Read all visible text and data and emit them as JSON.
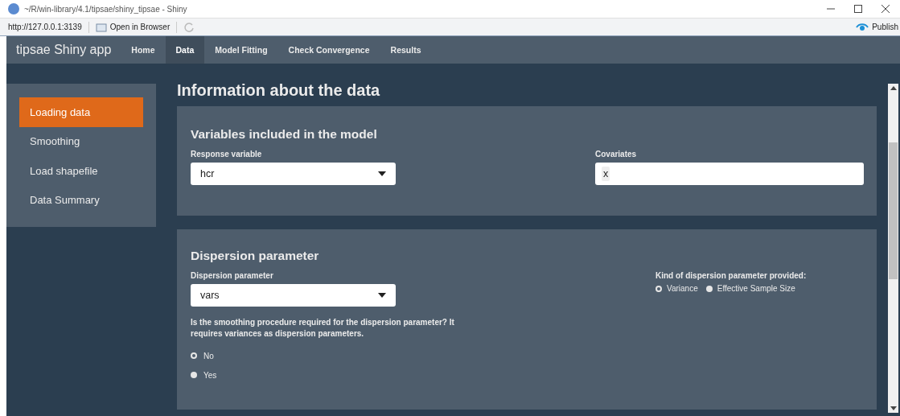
{
  "window": {
    "title": "~/R/win-library/4.1/tipsae/shiny_tipsae - Shiny"
  },
  "toolbar": {
    "url": "http://127.0.0.1:3139",
    "open_in_browser": "Open in Browser",
    "publish": "Publish"
  },
  "navbar": {
    "brand": "tipsae Shiny app",
    "tabs": [
      {
        "label": "Home",
        "selected": false
      },
      {
        "label": "Data",
        "selected": true
      },
      {
        "label": "Model Fitting",
        "selected": false
      },
      {
        "label": "Check Convergence",
        "selected": false
      },
      {
        "label": "Results",
        "selected": false
      }
    ]
  },
  "sidebar": {
    "items": [
      {
        "label": "Loading data",
        "selected": true
      },
      {
        "label": "Smoothing",
        "selected": false
      },
      {
        "label": "Load shapefile",
        "selected": false
      },
      {
        "label": "Data Summary",
        "selected": false
      }
    ]
  },
  "page_title": "Information about the data",
  "variables_card": {
    "title": "Variables included in the model",
    "response_label": "Response variable",
    "response_value": "hcr",
    "covariates_label": "Covariates",
    "covariates": [
      "x"
    ]
  },
  "dispersion_card": {
    "title": "Dispersion parameter",
    "param_label": "Dispersion parameter",
    "param_value": "vars",
    "smoothing_question": "Is the smoothing procedure required for the dispersion parameter? It requires variances as dispersion parameters.",
    "smoothing_options": [
      {
        "label": "No",
        "selected": true
      },
      {
        "label": "Yes",
        "selected": false
      }
    ],
    "kind_label": "Kind of dispersion parameter provided:",
    "kind_options": [
      {
        "label": "Variance",
        "selected": true
      },
      {
        "label": "Effective Sample Size",
        "selected": false
      }
    ]
  }
}
